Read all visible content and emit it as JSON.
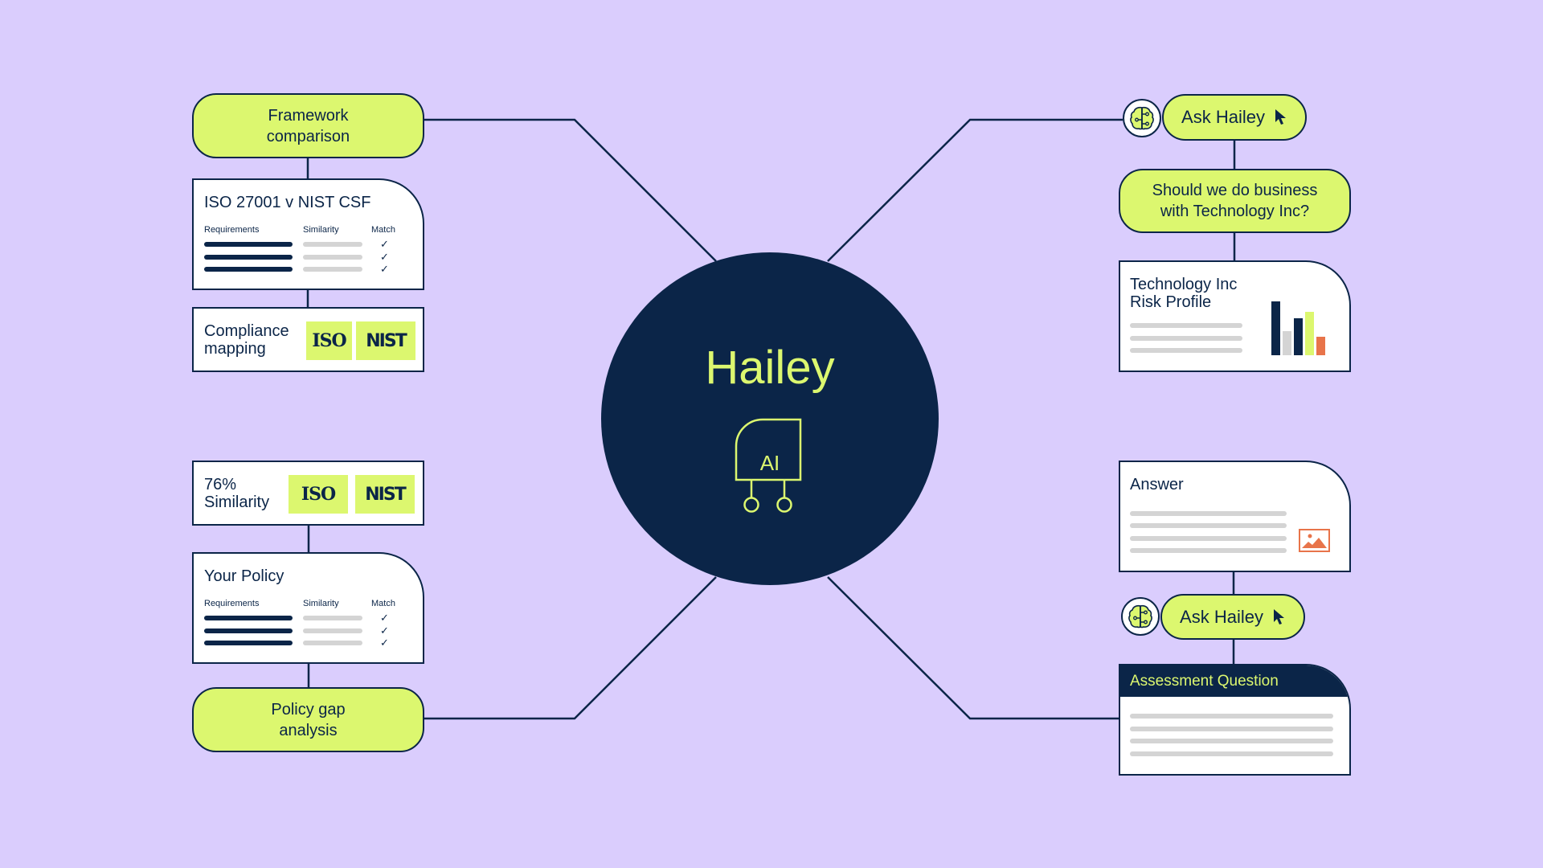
{
  "colors": {
    "background": "#dacdfd",
    "navy": "#0b2548",
    "lime": "#dcf76f",
    "grey": "#d4d4d4",
    "orange": "#e8744a",
    "white": "#ffffff"
  },
  "hub": {
    "title": "Hailey",
    "chip_label": "AI",
    "icon": "ai-chip-icon"
  },
  "left_top": {
    "framework_pill": {
      "line1": "Framework",
      "line2": "comparison"
    },
    "comparison_card": {
      "title": "ISO 27001 v NIST CSF",
      "columns": [
        "Requirements",
        "Similarity",
        "Match"
      ],
      "rows": [
        {
          "match": "✓"
        },
        {
          "match": "✓"
        },
        {
          "match": "✓"
        }
      ]
    },
    "compliance_card": {
      "line1": "Compliance",
      "line2": "mapping",
      "logos": [
        "ISO",
        "NIST"
      ]
    }
  },
  "left_bottom": {
    "similarity_card": {
      "line1": "76%",
      "line2": "Similarity",
      "logos": [
        "ISO",
        "NIST"
      ]
    },
    "policy_card": {
      "title": "Your Policy",
      "columns": [
        "Requirements",
        "Similarity",
        "Match"
      ],
      "rows": [
        {
          "match": "✓"
        },
        {
          "match": "✓"
        },
        {
          "match": "✓"
        }
      ]
    },
    "gap_pill": {
      "line1": "Policy gap",
      "line2": "analysis"
    }
  },
  "right_top": {
    "ask_button": {
      "label": "Ask Hailey",
      "icon": "brain-icon",
      "cursor": "cursor-arrow-icon"
    },
    "question_pill": {
      "line1": "Should we do business",
      "line2": "with Technology Inc?"
    },
    "risk_card": {
      "line1": "Technology Inc",
      "line2": "Risk Profile",
      "mini_chart": {
        "type": "bar",
        "values": [
          1.0,
          0.45,
          0.68,
          0.8,
          0.35
        ],
        "colors": [
          "#0b2548",
          "#d4d4d4",
          "#0b2548",
          "#dcf76f",
          "#e8744a"
        ]
      }
    }
  },
  "right_bottom": {
    "answer_card": {
      "title": "Answer",
      "image_icon": "image-icon"
    },
    "ask_button": {
      "label": "Ask Hailey",
      "icon": "brain-icon",
      "cursor": "cursor-arrow-icon"
    },
    "assessment_card": {
      "title": "Assessment Question"
    }
  }
}
